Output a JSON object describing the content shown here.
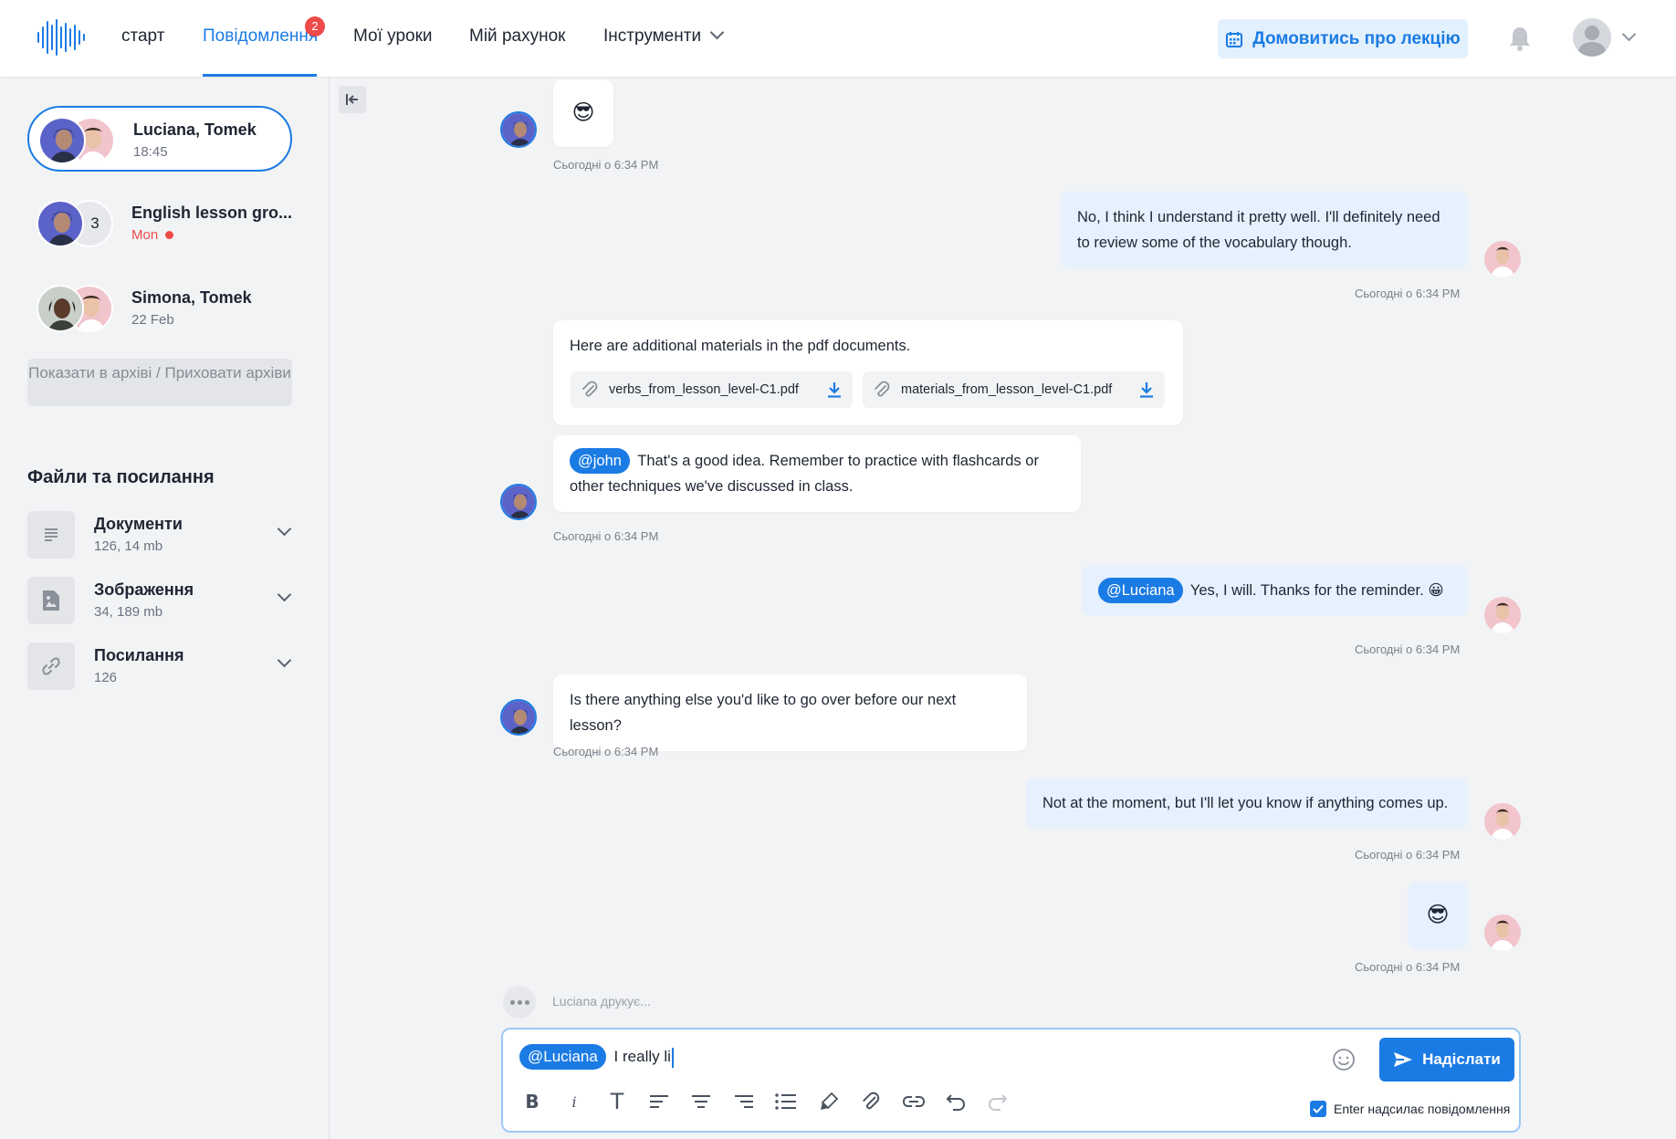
{
  "nav": {
    "items": [
      {
        "label": "старт"
      },
      {
        "label": "Повідомлення",
        "badge": "2"
      },
      {
        "label": "Мої уроки"
      },
      {
        "label": "Мій рахунок"
      },
      {
        "label": "Інструменти"
      }
    ],
    "book_button": "Домовитись про лекцію"
  },
  "sidebar": {
    "conversations": [
      {
        "name": "Luciana, Tomek",
        "time": "18:45",
        "active": true
      },
      {
        "name": "English lesson gro...",
        "time": "Mon",
        "count": "3",
        "unread": true
      },
      {
        "name": "Simona, Tomek",
        "time": "22 Feb"
      }
    ],
    "archive_button": "Показати в архіві / Приховати архіви",
    "files_title": "Файли та посилання",
    "files": [
      {
        "name": "Документи",
        "meta": "126, 14 mb",
        "icon": "document-icon"
      },
      {
        "name": "Зображення",
        "meta": "34, 189 mb",
        "icon": "image-icon"
      },
      {
        "name": "Посилання",
        "meta": "126",
        "icon": "link-icon"
      }
    ]
  },
  "chat": {
    "messages": [
      {
        "dir": "in",
        "text": "😎",
        "ts": "Сьогодні о 6:34 PM"
      },
      {
        "dir": "out",
        "text": "No, I think I understand it pretty well. I'll definitely need to review some of the vocabulary though.",
        "ts": "Сьогодні о 6:34 PM"
      },
      {
        "dir": "in",
        "text": "Here are additional materials in the pdf documents.",
        "attachments": [
          "verbs_from_lesson_level-C1.pdf",
          "materials_from_lesson_level-C1.pdf"
        ]
      },
      {
        "dir": "in",
        "mention": "@john",
        "text": "That's a good idea. Remember to practice with flashcards or other techniques we've discussed in class.",
        "ts": "Сьогодні о 6:34 PM"
      },
      {
        "dir": "out",
        "mention": "@Luciana",
        "text": "Yes, I will. Thanks for the reminder. 😀",
        "ts": "Сьогодні о 6:34 PM"
      },
      {
        "dir": "in",
        "text": "Is there anything else you'd like to go over before our next lesson?",
        "ts": "Сьогодні о 6:34 PM"
      },
      {
        "dir": "out",
        "text": "Not at the moment, but I'll let you know if anything comes up.",
        "ts": "Сьогодні о 6:34 PM"
      },
      {
        "dir": "out",
        "text": "😎",
        "ts": "Сьогодні о 6:34 PM"
      }
    ],
    "typing": "Luciana друкує..."
  },
  "composer": {
    "mention": "@Luciana",
    "value": "I really li",
    "send_label": "Надіслати",
    "enter_label": "Enter надсилає повідомлення",
    "enter_checked": true
  },
  "colors": {
    "accent": "#1b7be4",
    "badge": "#ef4a4a",
    "outgoing_bubble": "#e6f1fd"
  }
}
